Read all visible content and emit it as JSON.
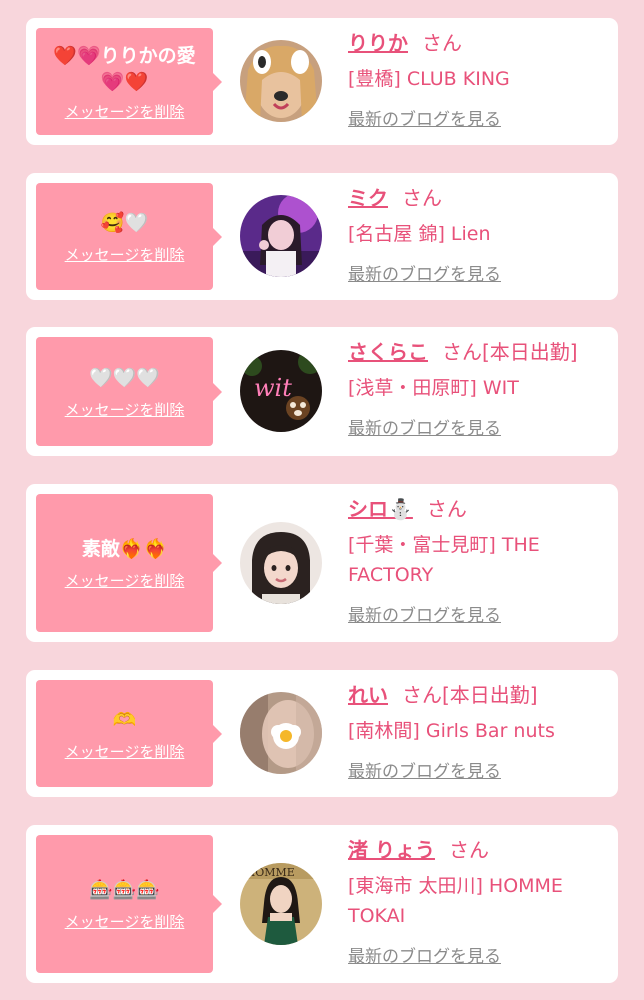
{
  "delete_label": "メッセージを削除",
  "san_label": "さん",
  "blog_label": "最新のブログを見る",
  "colors": {
    "page_background": "#f8d6dc",
    "bubble": "#ff9aab",
    "accent_text": "#e8517a",
    "link_gray": "#8b8b8b"
  },
  "messages": [
    {
      "message": "❤️💗りりかの愛💗❤️",
      "name": "りりか",
      "status": "",
      "shop": "[豊橋] CLUB KING",
      "avatar_icon": "avatar-photo-dog-filter"
    },
    {
      "message": "🥰🤍",
      "name": "ミク",
      "status": "",
      "shop": "[名古屋 錦] Lien",
      "avatar_icon": "avatar-photo-purple-light"
    },
    {
      "message": "🤍🤍🤍",
      "name": "さくらこ",
      "status": "[本日出勤]",
      "shop": "[浅草・田原町] WIT",
      "avatar_icon": "avatar-photo-neon-sign"
    },
    {
      "message": "素敵❤️‍🔥❤️‍🔥",
      "name": "シロ⛄",
      "status": "",
      "shop": "[千葉・富士見町] THE FACTORY",
      "avatar_icon": "avatar-photo-portrait"
    },
    {
      "message": "🫶",
      "name": "れい",
      "status": "[本日出勤]",
      "shop": "[南林間] Girls Bar nuts",
      "avatar_icon": "avatar-photo-blurred-flower"
    },
    {
      "message": "🎰🎰🎰",
      "name": "渚 りょう",
      "status": "",
      "shop": "[東海市 太田川] HOMME TOKAI",
      "avatar_icon": "avatar-photo-green-dress"
    }
  ]
}
